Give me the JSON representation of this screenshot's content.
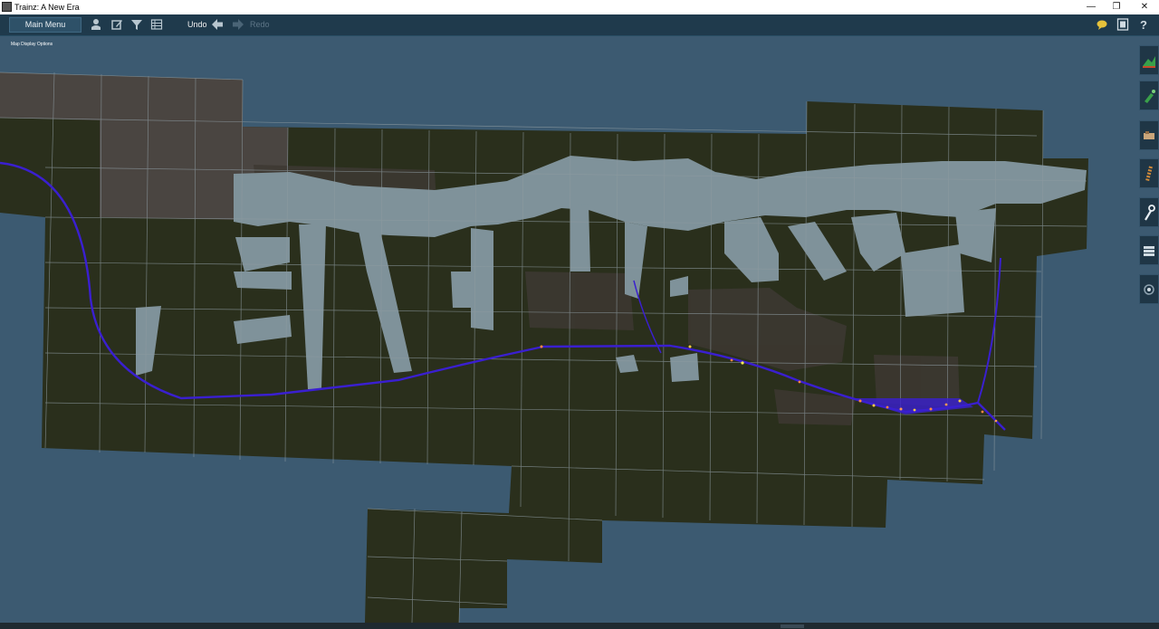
{
  "window": {
    "title": "Trainz: A New Era",
    "minimize": "—",
    "maximize": "❐",
    "close": "✕"
  },
  "toolbar": {
    "main_menu": "Main Menu",
    "undo": "Undo",
    "redo": "Redo",
    "icons": [
      "person-icon",
      "edit-icon",
      "filter-icon",
      "grid-icon"
    ],
    "right_icons": [
      "chat-icon",
      "film-icon",
      "help-icon"
    ],
    "help_glyph": "?"
  },
  "map": {
    "display_options_label": "Map Display Options"
  },
  "side_panel": {
    "tools": [
      "terrain-tool-icon",
      "paint-tool-icon",
      "objects-tool-icon",
      "track-tool-icon",
      "wrench-tool-icon",
      "layers-tool-icon",
      "settings-tool-icon"
    ]
  },
  "colors": {
    "background": "#3c5a71",
    "toolbar": "#1f3a4c",
    "ground": "#2a2f1c",
    "water": "#7f929a",
    "track": "#3a1fd0",
    "baseboard_raised": "#4a4541"
  }
}
